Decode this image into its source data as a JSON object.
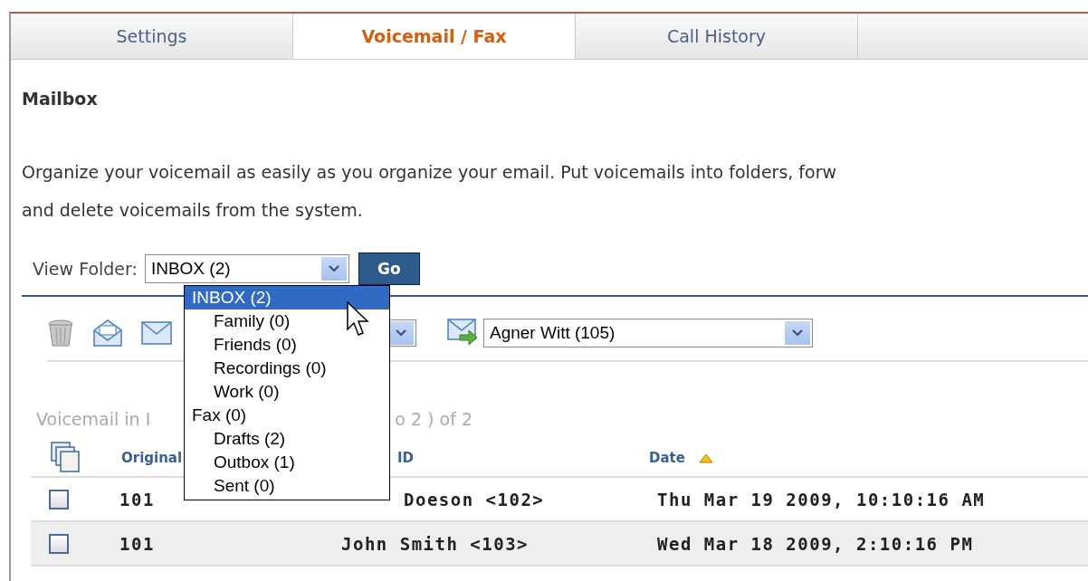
{
  "tabs": [
    {
      "label": "Settings",
      "selected": false
    },
    {
      "label": "Voicemail / Fax",
      "selected": true
    },
    {
      "label": "Call History",
      "selected": false
    },
    {
      "selected": false
    }
  ],
  "section_title": "Mailbox",
  "description_lines": [
    "Organize your voicemail as easily as you organize your email. Put voicemails into folders, forw",
    "and delete voicemails from the system."
  ],
  "view_folder": {
    "label": "View Folder:",
    "value": "INBOX (2)",
    "go_button": "Go"
  },
  "folder_dropdown": [
    {
      "label": "INBOX (2)",
      "selected": true,
      "children": [
        {
          "label": "Family (0)",
          "selected": false
        },
        {
          "label": "Friends (0)",
          "selected": false
        },
        {
          "label": "Recordings (0)",
          "selected": false
        },
        {
          "label": "Work (0)",
          "selected": false
        }
      ]
    },
    {
      "label": "Fax (0)",
      "selected": false,
      "children": [
        {
          "label": "Drafts (2)",
          "selected": false
        },
        {
          "label": "Outbox (1)",
          "selected": false
        },
        {
          "label": "Sent (0)",
          "selected": false
        }
      ]
    }
  ],
  "forward_to": {
    "value": "Agner Witt (105)"
  },
  "status_parts": [
    "Voicemail in I",
    "o 2 ) of 2"
  ],
  "table": {
    "columns": [
      "Original",
      "ID",
      "Date"
    ],
    "rows": [
      {
        "checked": false,
        "original": "101",
        "caller": "Doeson <102>",
        "date": "Thu Mar 19 2009, 10:10:16 AM"
      },
      {
        "checked": false,
        "original": "101",
        "caller": "John Smith <103>",
        "date": "Wed Mar 18 2009, 2:10:16 PM"
      }
    ]
  }
}
